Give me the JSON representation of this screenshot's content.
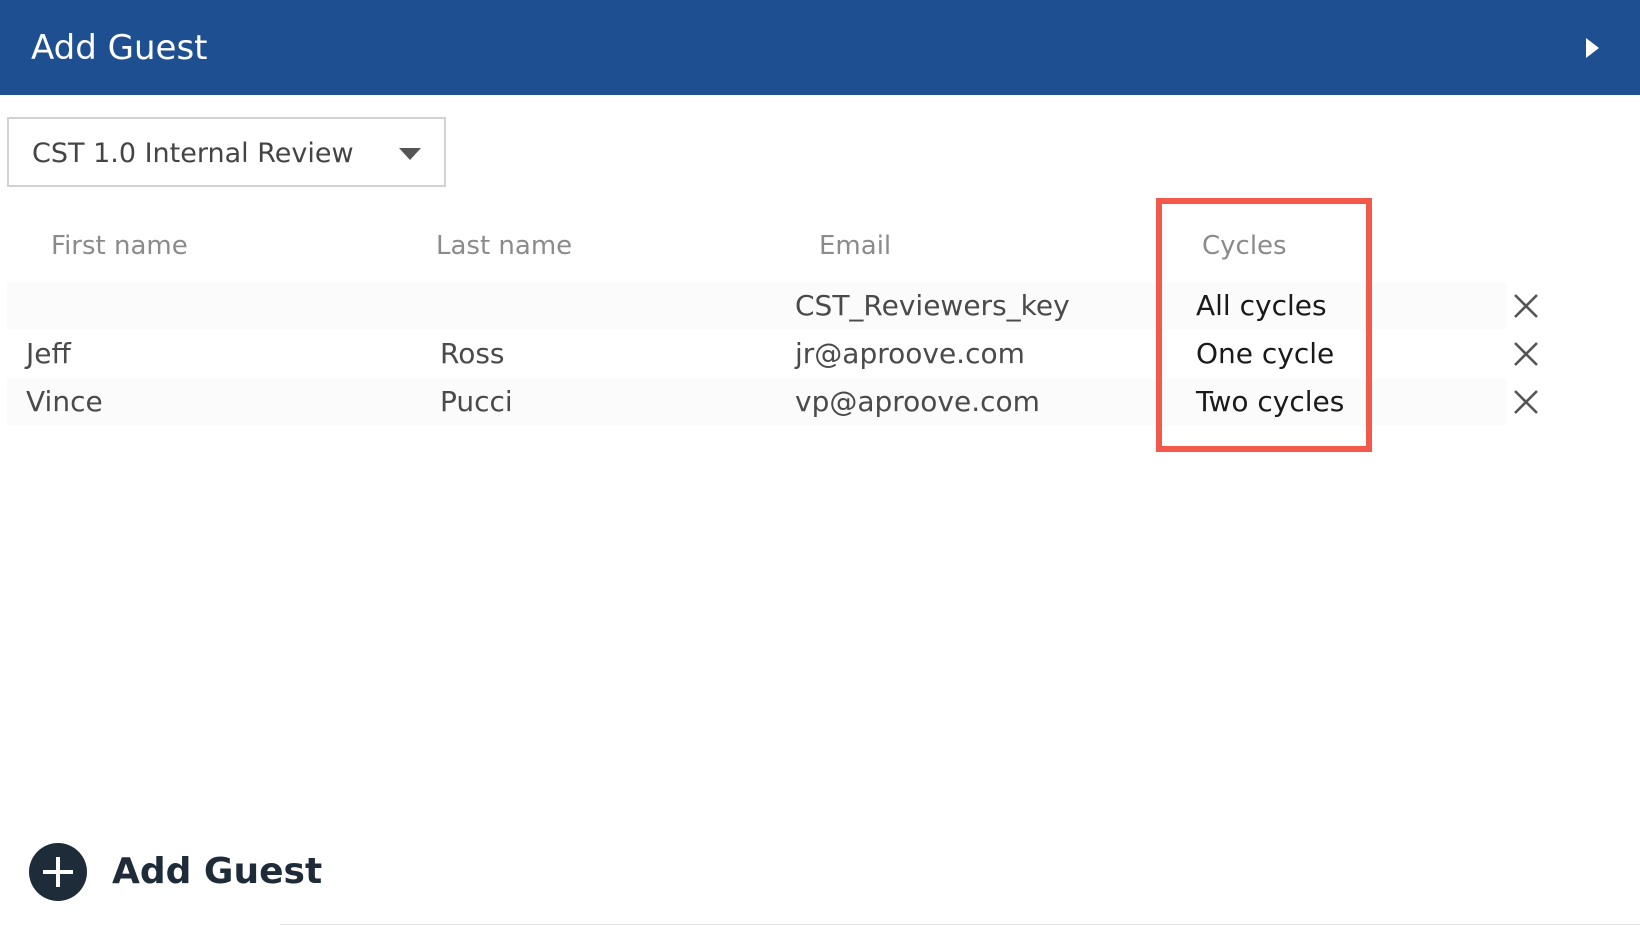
{
  "header": {
    "title": "Add Guest",
    "collapse_icon": "caret-right-icon"
  },
  "review_select": {
    "value": "CST 1.0 Internal Review",
    "icon": "caret-down-icon"
  },
  "table": {
    "columns": [
      "First name",
      "Last name",
      "Email",
      "Cycles"
    ],
    "rows": [
      {
        "first_name": "",
        "last_name": "",
        "email": "CST_Reviewers_key",
        "cycles": "All cycles"
      },
      {
        "first_name": "Jeff",
        "last_name": "Ross",
        "email": "jr@aproove.com",
        "cycles": "One cycle"
      },
      {
        "first_name": "Vince",
        "last_name": "Pucci",
        "email": "vp@aproove.com",
        "cycles": "Two cycles"
      }
    ],
    "remove_icon": "close-icon"
  },
  "add_guest": {
    "label": "Add Guest",
    "icon": "plus-circle-icon"
  },
  "colors": {
    "header_bg": "#1d4f91",
    "highlight": "#f2594b",
    "add_button": "#1e2b38"
  }
}
